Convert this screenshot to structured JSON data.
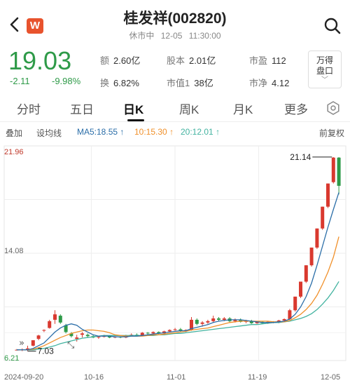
{
  "header": {
    "title": "桂发祥(002820)",
    "status": "休市中",
    "date": "12-05",
    "time": "11:30:00"
  },
  "quote": {
    "price": "19.03",
    "change": "-2.11",
    "change_pct": "-9.98%",
    "metrics": [
      {
        "key": "额",
        "value": "2.60亿"
      },
      {
        "key": "股本",
        "value": "2.01亿"
      },
      {
        "key": "市盈",
        "value": "112"
      },
      {
        "key": "换",
        "value": "6.82%"
      },
      {
        "key": "市值1",
        "value": "38亿"
      },
      {
        "key": "市净",
        "value": "4.12"
      }
    ],
    "wd_button": {
      "line1": "万得",
      "line2": "盘口"
    }
  },
  "tabs": [
    "分时",
    "五日",
    "日K",
    "周K",
    "月K",
    "更多"
  ],
  "active_tab": "日K",
  "ma_bar": {
    "overlay": "叠加",
    "draw": "设均线",
    "ma5": "MA5:18.55",
    "ma10": "10:15.30",
    "ma20": "20:12.01",
    "adjust": "前复权",
    "colors": {
      "ma5": "#2b6ea8",
      "ma10": "#f0902a",
      "ma20": "#43b3a0",
      "up": "#d9392f",
      "down": "#2e9a48"
    }
  },
  "chart_data": {
    "type": "candlestick",
    "y_labels": {
      "high": "21.96",
      "mid": "14.08",
      "low": "6.21"
    },
    "ylim": [
      6.21,
      21.96
    ],
    "x_labels": [
      "2024-09-20",
      "10-16",
      "11-01",
      "11-19",
      "12-05"
    ],
    "max_marker": "21.14",
    "min_marker": "7.03",
    "candles": [
      [
        7.0,
        7.05,
        6.95,
        7.0
      ],
      [
        7.0,
        7.1,
        6.9,
        7.02
      ],
      [
        7.03,
        7.3,
        6.9,
        7.1
      ],
      [
        7.3,
        7.7,
        7.25,
        7.7
      ],
      [
        7.8,
        8.1,
        7.7,
        8.05
      ],
      [
        8.4,
        8.5,
        8.3,
        8.45
      ],
      [
        8.6,
        9.2,
        8.55,
        9.1
      ],
      [
        9.2,
        9.9,
        8.9,
        9.6
      ],
      [
        9.5,
        9.6,
        8.9,
        9.0
      ],
      [
        8.8,
        8.9,
        8.2,
        8.3
      ],
      [
        8.2,
        8.3,
        7.9,
        8.0
      ],
      [
        7.8,
        8.1,
        7.6,
        7.9
      ],
      [
        8.1,
        8.3,
        7.9,
        8.2
      ],
      [
        8.1,
        8.2,
        7.9,
        8.0
      ],
      [
        8.0,
        8.1,
        7.85,
        7.9
      ],
      [
        7.9,
        8.0,
        7.8,
        7.95
      ],
      [
        7.95,
        8.1,
        7.9,
        8.0
      ],
      [
        8.0,
        8.05,
        7.85,
        7.9
      ],
      [
        7.9,
        8.0,
        7.85,
        7.95
      ],
      [
        7.95,
        8.0,
        7.85,
        7.9
      ],
      [
        7.9,
        8.1,
        7.85,
        8.05
      ],
      [
        8.05,
        8.2,
        8.0,
        8.1
      ],
      [
        8.1,
        8.2,
        8.0,
        8.05
      ],
      [
        8.05,
        8.3,
        8.0,
        8.25
      ],
      [
        8.25,
        8.3,
        8.1,
        8.2
      ],
      [
        8.2,
        8.35,
        8.1,
        8.3
      ],
      [
        8.3,
        8.35,
        8.15,
        8.2
      ],
      [
        8.2,
        8.4,
        8.15,
        8.35
      ],
      [
        8.35,
        8.5,
        8.3,
        8.45
      ],
      [
        8.45,
        8.6,
        8.4,
        8.5
      ],
      [
        8.5,
        8.6,
        8.3,
        8.4
      ],
      [
        8.4,
        8.5,
        8.3,
        8.45
      ],
      [
        8.45,
        9.4,
        8.4,
        9.2
      ],
      [
        9.2,
        9.3,
        8.8,
        8.9
      ],
      [
        8.9,
        9.1,
        8.7,
        9.0
      ],
      [
        9.0,
        9.2,
        8.9,
        9.1
      ],
      [
        9.1,
        9.5,
        9.0,
        9.3
      ],
      [
        9.3,
        9.4,
        9.1,
        9.2
      ],
      [
        9.2,
        9.4,
        9.1,
        9.3
      ],
      [
        9.3,
        9.4,
        9.0,
        9.1
      ],
      [
        9.1,
        9.3,
        9.0,
        9.2
      ],
      [
        9.2,
        9.3,
        9.0,
        9.05
      ],
      [
        9.05,
        9.2,
        8.95,
        9.1
      ],
      [
        9.1,
        9.2,
        8.9,
        8.95
      ],
      [
        8.95,
        9.1,
        8.9,
        9.05
      ],
      [
        9.05,
        9.1,
        8.9,
        8.95
      ],
      [
        8.95,
        9.1,
        8.9,
        9.05
      ],
      [
        9.05,
        9.1,
        8.95,
        9.0
      ],
      [
        9.0,
        9.2,
        8.95,
        9.15
      ],
      [
        9.15,
        9.3,
        9.1,
        9.25
      ],
      [
        9.25,
        10.0,
        9.2,
        9.9
      ],
      [
        9.9,
        10.9,
        9.8,
        10.9
      ],
      [
        10.9,
        12.0,
        10.8,
        12.0
      ],
      [
        12.0,
        13.2,
        11.9,
        13.2
      ],
      [
        13.2,
        14.5,
        13.1,
        14.5
      ],
      [
        14.5,
        15.9,
        14.4,
        15.9
      ],
      [
        15.9,
        17.5,
        15.8,
        17.5
      ],
      [
        17.5,
        19.2,
        17.4,
        19.2
      ],
      [
        19.3,
        21.14,
        19.2,
        21.1
      ],
      [
        21.1,
        21.14,
        18.4,
        19.03
      ]
    ],
    "ma5": [
      7.0,
      7.0,
      7.0,
      7.1,
      7.3,
      7.5,
      7.9,
      8.3,
      8.6,
      8.8,
      8.9,
      8.8,
      8.5,
      8.3,
      8.1,
      8.0,
      8.0,
      8.0,
      7.95,
      7.95,
      7.95,
      8.0,
      8.0,
      8.05,
      8.1,
      8.15,
      8.2,
      8.25,
      8.3,
      8.35,
      8.4,
      8.4,
      8.55,
      8.65,
      8.75,
      8.85,
      9.0,
      9.1,
      9.15,
      9.2,
      9.2,
      9.2,
      9.15,
      9.1,
      9.05,
      9.0,
      9.0,
      9.0,
      9.05,
      9.1,
      9.25,
      9.6,
      10.15,
      10.9,
      11.9,
      13.2,
      14.6,
      16.0,
      17.3,
      18.55
    ],
    "ma10": [
      7.0,
      7.0,
      7.0,
      7.05,
      7.15,
      7.3,
      7.5,
      7.7,
      7.9,
      8.05,
      8.2,
      8.3,
      8.4,
      8.45,
      8.45,
      8.4,
      8.35,
      8.25,
      8.1,
      8.05,
      8.0,
      8.0,
      8.0,
      8.0,
      8.05,
      8.1,
      8.1,
      8.15,
      8.2,
      8.25,
      8.3,
      8.35,
      8.45,
      8.5,
      8.55,
      8.6,
      8.7,
      8.8,
      8.9,
      9.0,
      9.05,
      9.1,
      9.1,
      9.1,
      9.1,
      9.1,
      9.1,
      9.05,
      9.05,
      9.05,
      9.15,
      9.35,
      9.6,
      9.95,
      10.4,
      11.0,
      11.8,
      12.7,
      13.8,
      15.3
    ],
    "ma20": [
      7.0,
      7.0,
      7.0,
      7.0,
      7.05,
      7.1,
      7.2,
      7.3,
      7.45,
      7.55,
      7.65,
      7.75,
      7.85,
      7.9,
      7.95,
      8.0,
      8.05,
      8.05,
      8.05,
      8.05,
      8.05,
      8.05,
      8.05,
      8.05,
      8.05,
      8.05,
      8.1,
      8.1,
      8.15,
      8.2,
      8.2,
      8.25,
      8.3,
      8.35,
      8.4,
      8.45,
      8.5,
      8.55,
      8.6,
      8.65,
      8.7,
      8.75,
      8.8,
      8.85,
      8.85,
      8.9,
      8.95,
      9.0,
      9.0,
      9.05,
      9.1,
      9.2,
      9.3,
      9.45,
      9.65,
      9.95,
      10.35,
      10.8,
      11.35,
      12.01
    ]
  }
}
